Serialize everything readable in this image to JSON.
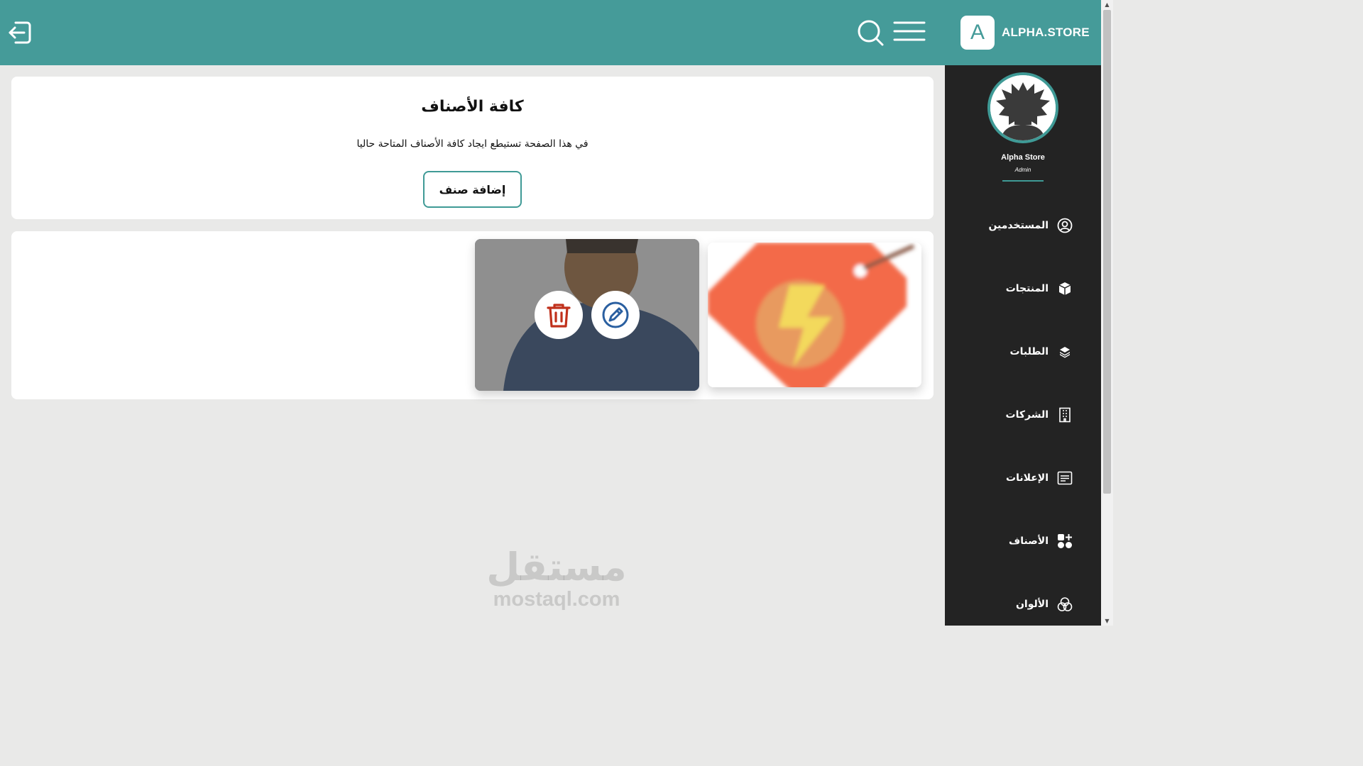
{
  "header": {
    "logo_letter": "A",
    "brand": "ALPHA.STORE",
    "icons": {
      "logout": "logout-icon",
      "search": "search-icon",
      "menu": "menu-icon"
    },
    "background_color": "#459b99"
  },
  "sidebar": {
    "profile": {
      "name": "Alpha Store",
      "role": "Admin"
    },
    "items": [
      {
        "label": "المستخدمين",
        "icon": "user-circle-icon"
      },
      {
        "label": "المنتجات",
        "icon": "box-icon"
      },
      {
        "label": "الطلبات",
        "icon": "layers-icon"
      },
      {
        "label": "الشركات",
        "icon": "building-icon"
      },
      {
        "label": "الإعلانات",
        "icon": "ad-board-icon"
      },
      {
        "label": "الأصناف",
        "icon": "categories-icon"
      },
      {
        "label": "الألوان",
        "icon": "palette-icon"
      }
    ],
    "background_color": "#232323",
    "accent_color": "#3f9a96"
  },
  "main": {
    "title": "كافة الأصناف",
    "subtitle": "في هذا الصفحة تستيطع ايجاد كافة الأصناف المتاحة حاليا",
    "add_button": "إضافة صنف",
    "categories": [
      {
        "image": "lightning-tag-image"
      },
      {
        "image": "person-image",
        "actions": [
          "edit-icon",
          "delete-icon"
        ]
      }
    ]
  },
  "watermark": {
    "arabic": "مستقل",
    "latin": "mostaql.com"
  }
}
